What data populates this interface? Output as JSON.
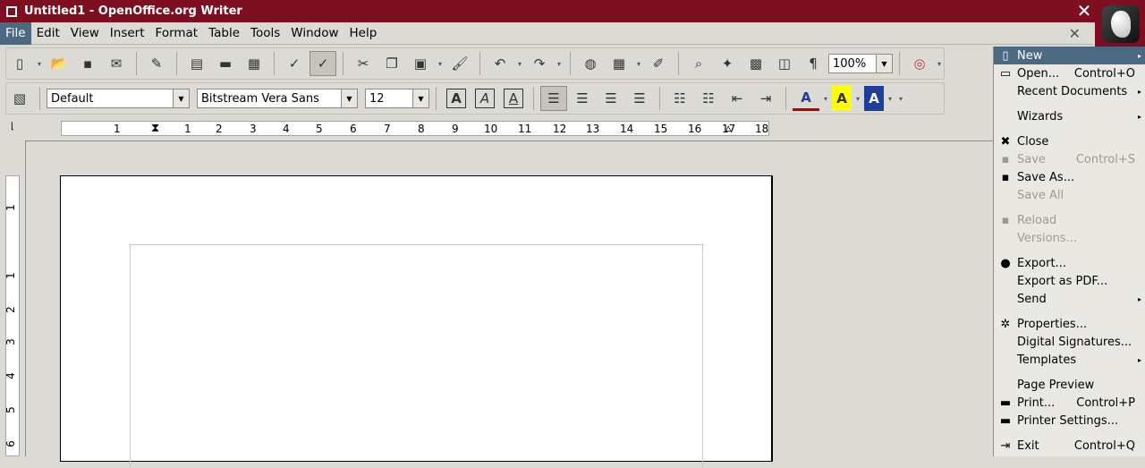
{
  "window": {
    "title": "Untitled1 - OpenOffice.org Writer",
    "close_glyph": "✕"
  },
  "menubar": {
    "items": [
      "File",
      "Edit",
      "View",
      "Insert",
      "Format",
      "Table",
      "Tools",
      "Window",
      "Help"
    ],
    "doc_close_glyph": "✕"
  },
  "toolbar_standard": {
    "zoom": "100%"
  },
  "toolbar_formatting": {
    "style": "Default",
    "font": "Bitstream Vera Sans",
    "size": "12",
    "bold_glyph": "A",
    "italic_glyph": "A",
    "underline_glyph": "A",
    "font_color_glyph": "A",
    "highlight_glyph": "A",
    "char_bg_glyph": "A"
  },
  "ruler": {
    "h_labels": [
      "1",
      "1",
      "2",
      "3",
      "4",
      "5",
      "6",
      "7",
      "8",
      "9",
      "10",
      "11",
      "12",
      "13",
      "14",
      "15",
      "16",
      "17",
      "18"
    ],
    "v_labels": [
      "1",
      "1",
      "2",
      "3",
      "4",
      "5",
      "6"
    ]
  },
  "file_menu": {
    "items": [
      {
        "label": "New",
        "accel": "",
        "submenu": true,
        "disabled": false,
        "highlight": true,
        "icon": "new-doc-icon",
        "glyph": "▯"
      },
      {
        "label": "Open...",
        "accel": "Control+O",
        "submenu": false,
        "disabled": false,
        "icon": "open-folder-icon",
        "glyph": "▭"
      },
      {
        "label": "Recent Documents",
        "accel": "",
        "submenu": true,
        "disabled": false,
        "icon": "",
        "glyph": ""
      },
      {
        "label": "Wizards",
        "accel": "",
        "submenu": true,
        "disabled": false,
        "icon": "",
        "glyph": ""
      },
      {
        "label": "Close",
        "accel": "",
        "submenu": false,
        "disabled": false,
        "icon": "close-icon",
        "glyph": "✖"
      },
      {
        "label": "Save",
        "accel": "Control+S",
        "submenu": false,
        "disabled": true,
        "icon": "save-icon",
        "glyph": "▪"
      },
      {
        "label": "Save As...",
        "accel": "",
        "submenu": false,
        "disabled": false,
        "icon": "save-as-icon",
        "glyph": "▪"
      },
      {
        "label": "Save All",
        "accel": "",
        "submenu": false,
        "disabled": true,
        "icon": "",
        "glyph": ""
      },
      {
        "label": "Reload",
        "accel": "",
        "submenu": false,
        "disabled": true,
        "icon": "reload-icon",
        "glyph": "▪"
      },
      {
        "label": "Versions...",
        "accel": "",
        "submenu": false,
        "disabled": true,
        "icon": "",
        "glyph": ""
      },
      {
        "label": "Export...",
        "accel": "",
        "submenu": false,
        "disabled": false,
        "icon": "export-icon",
        "glyph": "●"
      },
      {
        "label": "Export as PDF...",
        "accel": "",
        "submenu": false,
        "disabled": false,
        "icon": "",
        "glyph": ""
      },
      {
        "label": "Send",
        "accel": "",
        "submenu": true,
        "disabled": false,
        "icon": "",
        "glyph": ""
      },
      {
        "label": "Properties...",
        "accel": "",
        "submenu": false,
        "disabled": false,
        "icon": "properties-icon",
        "glyph": "✲"
      },
      {
        "label": "Digital Signatures...",
        "accel": "",
        "submenu": false,
        "disabled": false,
        "icon": "",
        "glyph": ""
      },
      {
        "label": "Templates",
        "accel": "",
        "submenu": true,
        "disabled": false,
        "icon": "",
        "glyph": ""
      },
      {
        "label": "Page Preview",
        "accel": "",
        "submenu": false,
        "disabled": false,
        "icon": "",
        "glyph": ""
      },
      {
        "label": "Print...",
        "accel": "Control+P",
        "submenu": false,
        "disabled": false,
        "icon": "print-icon",
        "glyph": "▬"
      },
      {
        "label": "Printer Settings...",
        "accel": "",
        "submenu": false,
        "disabled": false,
        "icon": "printer-settings-icon",
        "glyph": "▬"
      },
      {
        "label": "Exit",
        "accel": "Control+Q",
        "submenu": false,
        "disabled": false,
        "icon": "exit-icon",
        "glyph": "⇥"
      }
    ]
  }
}
